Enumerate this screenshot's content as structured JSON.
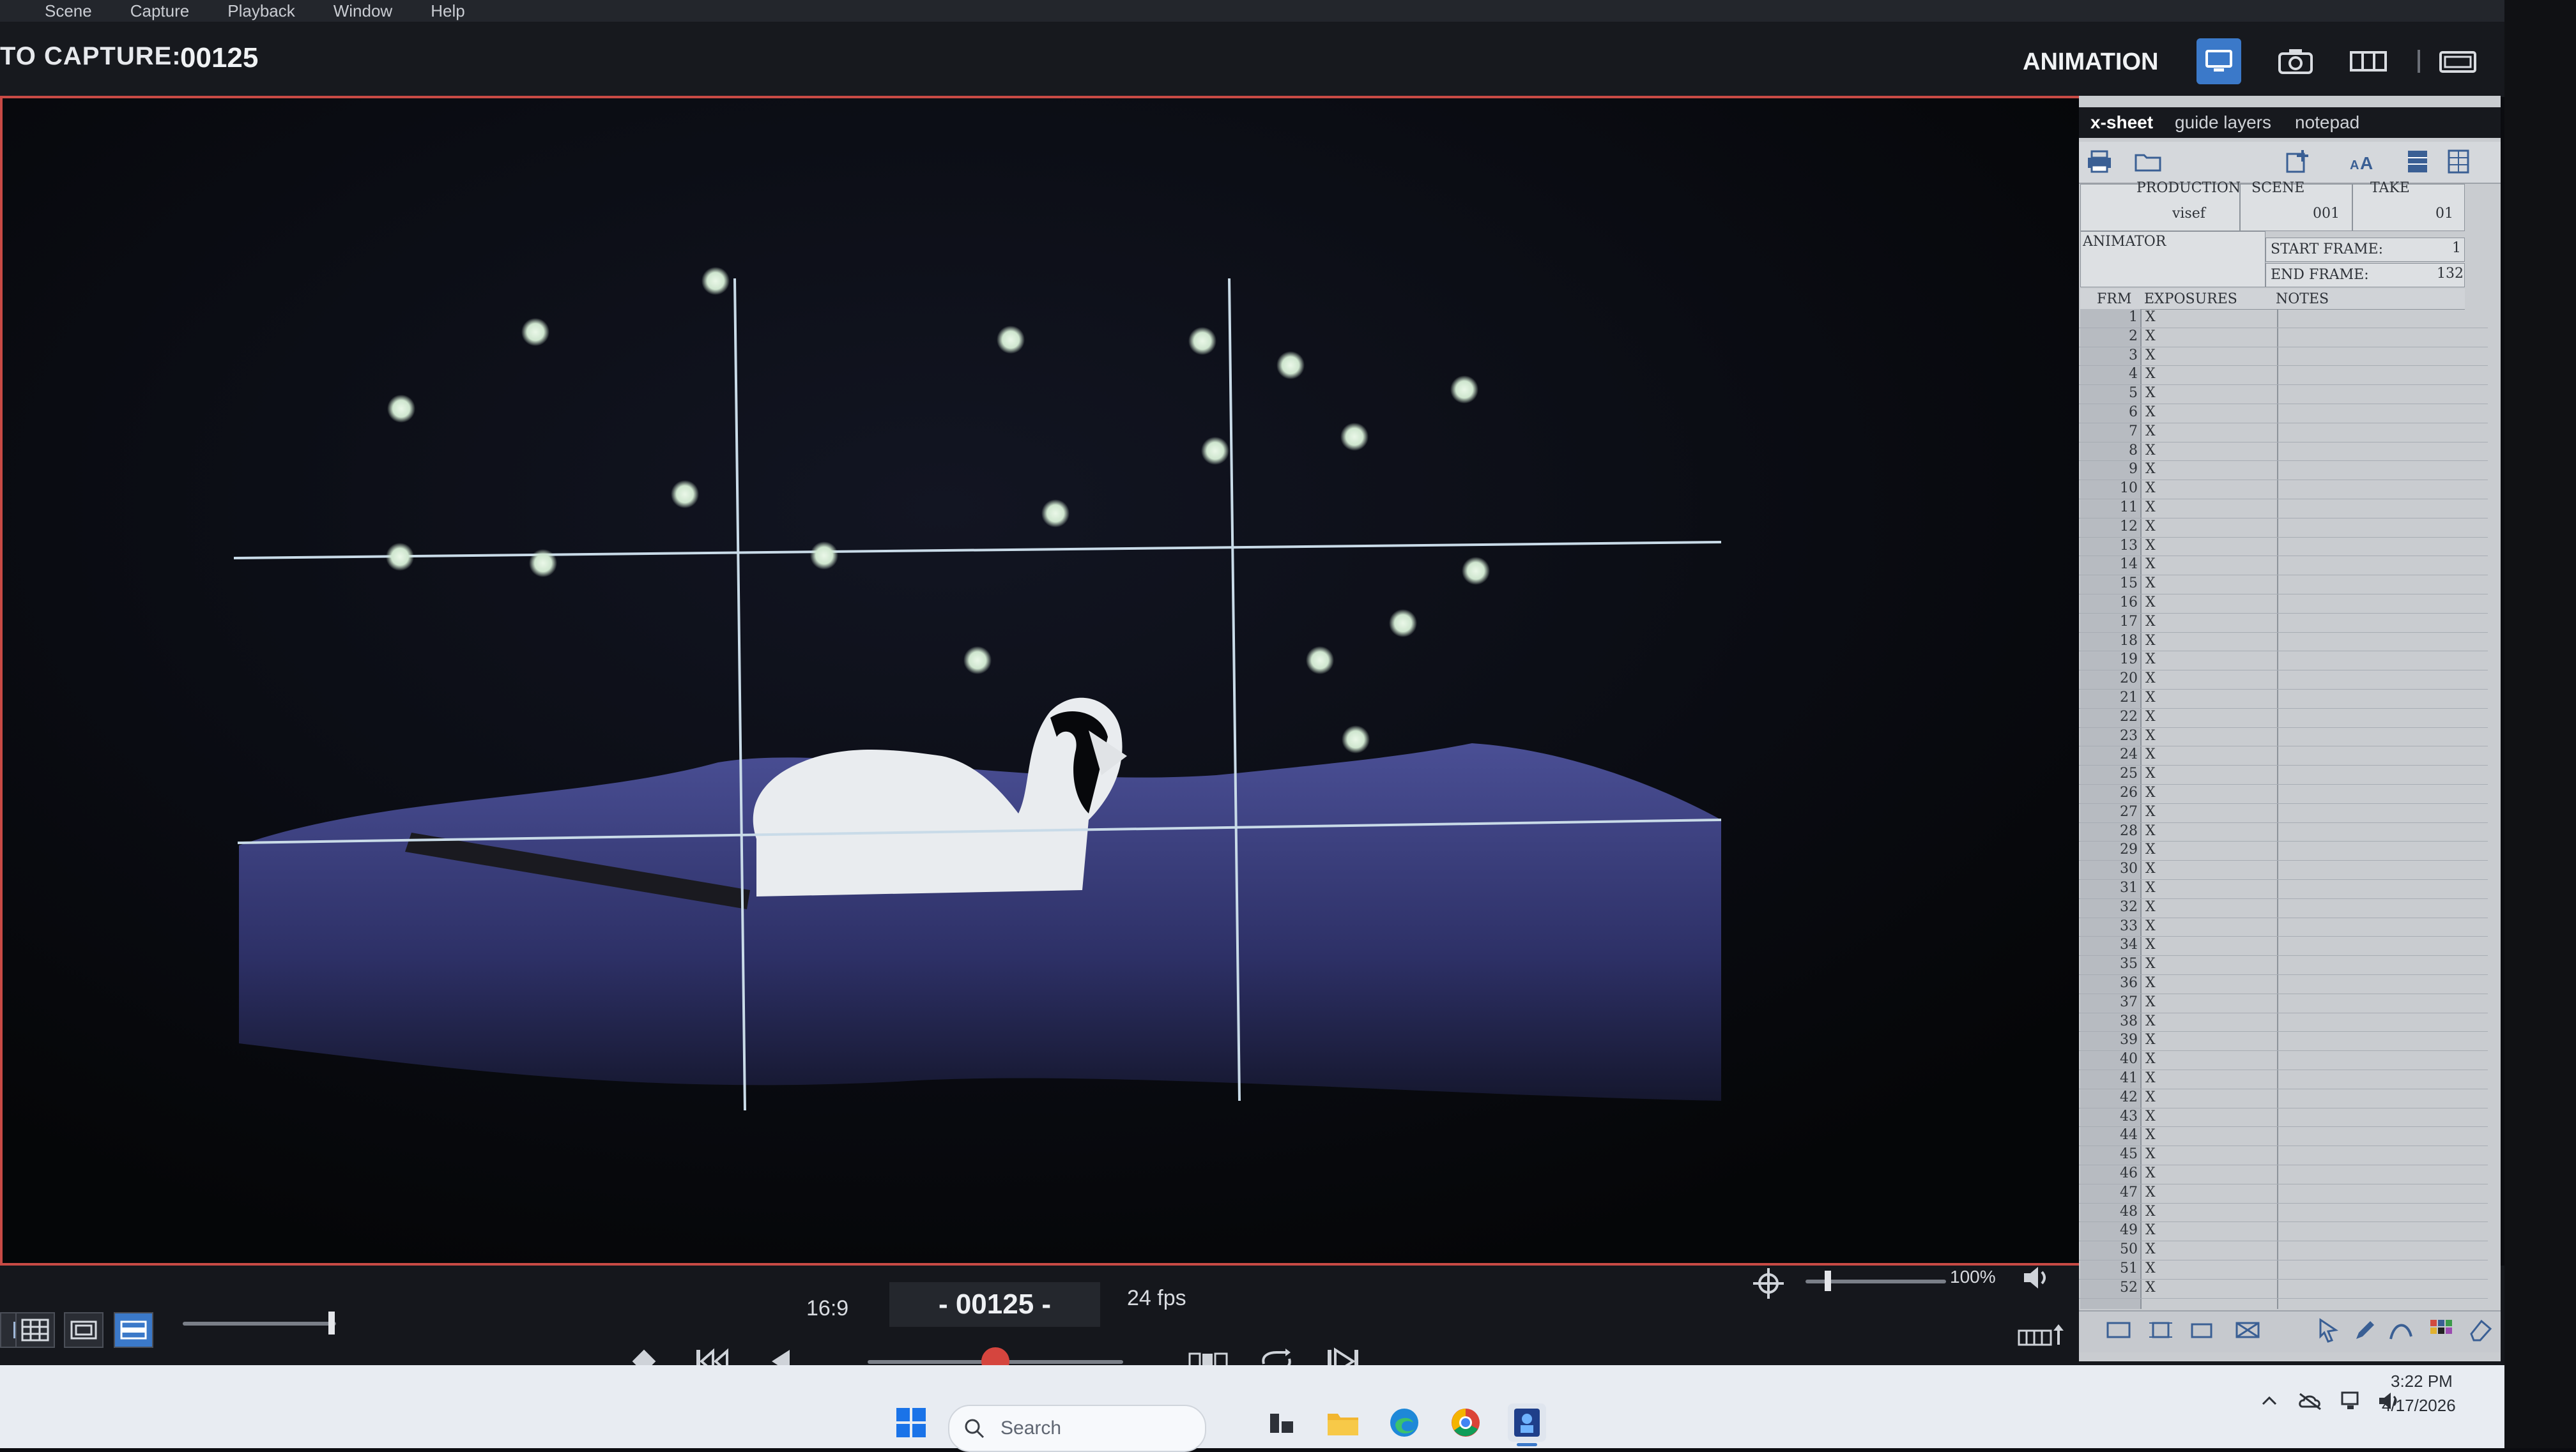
{
  "menu": [
    "Scene",
    "Capture",
    "Playback",
    "Window",
    "Help"
  ],
  "header": {
    "capture_label": "TO CAPTURE:",
    "capture_value": "00125",
    "mode_label": "ANIMATION",
    "icons": [
      "monitor-icon",
      "camera-icon",
      "timeline-icon",
      "window-icon"
    ]
  },
  "xsheet": {
    "tabs": [
      "x-sheet",
      "guide layers",
      "notepad"
    ],
    "production_label": "PRODUCTION",
    "production_value": "visef",
    "scene_label": "SCENE",
    "scene_value": "001",
    "take_label": "TAKE",
    "take_value": "01",
    "animator_label": "ANIMATOR",
    "start_frame_label": "START FRAME:",
    "start_frame_value": "1",
    "end_frame_label": "END FRAME:",
    "end_frame_value": "132",
    "col_frm": "FRM",
    "col_exposures": "EXPOSURES",
    "col_notes": "NOTES",
    "exposure_mark": "X",
    "rows": [
      1,
      2,
      3,
      4,
      5,
      6,
      7,
      8,
      9,
      10,
      11,
      12,
      13,
      14,
      15,
      16,
      17,
      18,
      19,
      20,
      21,
      22,
      23,
      24,
      25,
      26,
      27,
      28,
      29,
      30,
      31,
      32,
      33,
      34,
      35,
      36,
      37,
      38,
      39,
      40,
      41,
      42,
      43,
      44,
      45,
      46,
      47,
      48,
      49,
      50,
      51,
      52
    ]
  },
  "bottom": {
    "aspect": "16:9",
    "frame_display": "- 00125 -",
    "fps": "24 fps",
    "zoom": "100%"
  },
  "taskbar": {
    "search_placeholder": "Search",
    "time": "3:22 PM",
    "date": "4/17/2026"
  },
  "colors": {
    "accent_blue": "#3b79c9",
    "viewer_border": "#c84a45",
    "fabric": "#3a3d78",
    "guide_lines": "#c9dbe8",
    "dots": "#d9ecd9"
  }
}
